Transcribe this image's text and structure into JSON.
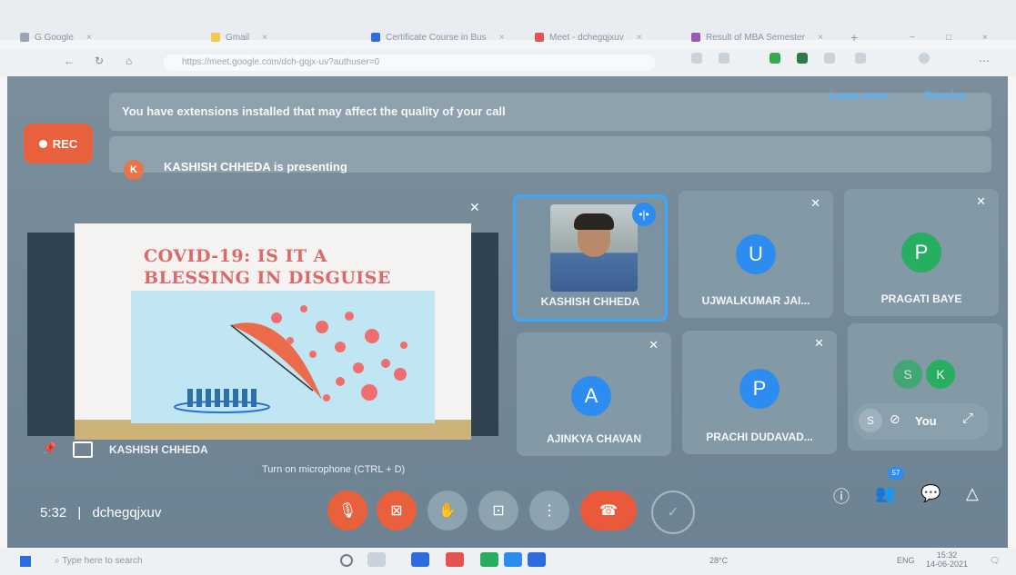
{
  "browser": {
    "tabs": [
      {
        "label": "G Google",
        "color": "#9aa5b1"
      },
      {
        "label": "Gmail",
        "color": "#f2c94c"
      },
      {
        "label": "Certificate Course in Bus",
        "color": "#2d6cdf"
      },
      {
        "label": "Meet - dchegqjxuv",
        "color": "#e55353"
      },
      {
        "label": "Result of MBA Semester",
        "color": "#9b59b6"
      }
    ],
    "new_tab": "+",
    "url": "https://meet.google.com/dch-gqjx-uv?authuser=0",
    "window_controls": [
      "−",
      "□",
      "×"
    ]
  },
  "banner": {
    "message": "You have extensions installed that may affect the quality of your call",
    "learn_more": "Learn more",
    "dismiss": "Dismiss"
  },
  "recording": {
    "label": "REC",
    "color": "#e9603d"
  },
  "presenting": {
    "avatar_letter": "K",
    "text": "KASHISH CHHEDA is presenting"
  },
  "slide": {
    "title_line1": "COVID-19: IS IT A",
    "title_line2": "BLESSING IN DISGUISE",
    "presenter_name": "KASHISH CHHEDA"
  },
  "participants": [
    {
      "name": "KASHISH CHHEDA",
      "letter": "",
      "avatar_color": "",
      "speaking": true
    },
    {
      "name": "UJWALKUMAR JAI...",
      "letter": "U",
      "avatar_color": "#2d8cf0",
      "speaking": false
    },
    {
      "name": "PRAGATI BAYE",
      "letter": "P",
      "avatar_color": "#27ae60",
      "speaking": false
    },
    {
      "name": "AJINKYA CHAVAN",
      "letter": "A",
      "avatar_color": "#2d8cf0",
      "speaking": false
    },
    {
      "name": "PRACHI DUDAVAD...",
      "letter": "P",
      "avatar_color": "#2d8cf0",
      "speaking": false
    }
  ],
  "others_tile": {
    "letters": [
      "S",
      "K"
    ],
    "colors": [
      "#27ae60",
      "#27ae60"
    ]
  },
  "self_view": {
    "label": "You",
    "letter": "S"
  },
  "tooltip": "Turn on microphone (CTRL + D)",
  "meeting": {
    "time": "5:32",
    "separator": "|",
    "code": "dchegqjxuv"
  },
  "participant_count": "57",
  "icons": {
    "mic_off": "mic-off-icon",
    "cam_off": "camera-off-icon",
    "hand": "raise-hand-icon",
    "present": "present-screen-icon",
    "more": "more-options-icon",
    "end": "end-call-icon",
    "info": "info-icon",
    "people": "people-icon",
    "chat": "chat-icon",
    "activities": "activities-icon"
  },
  "taskbar": {
    "search_placeholder": "Type here to search",
    "weather": "28°C",
    "lang": "ENG",
    "clock_time": "15:32",
    "clock_date": "14-06-2021"
  }
}
